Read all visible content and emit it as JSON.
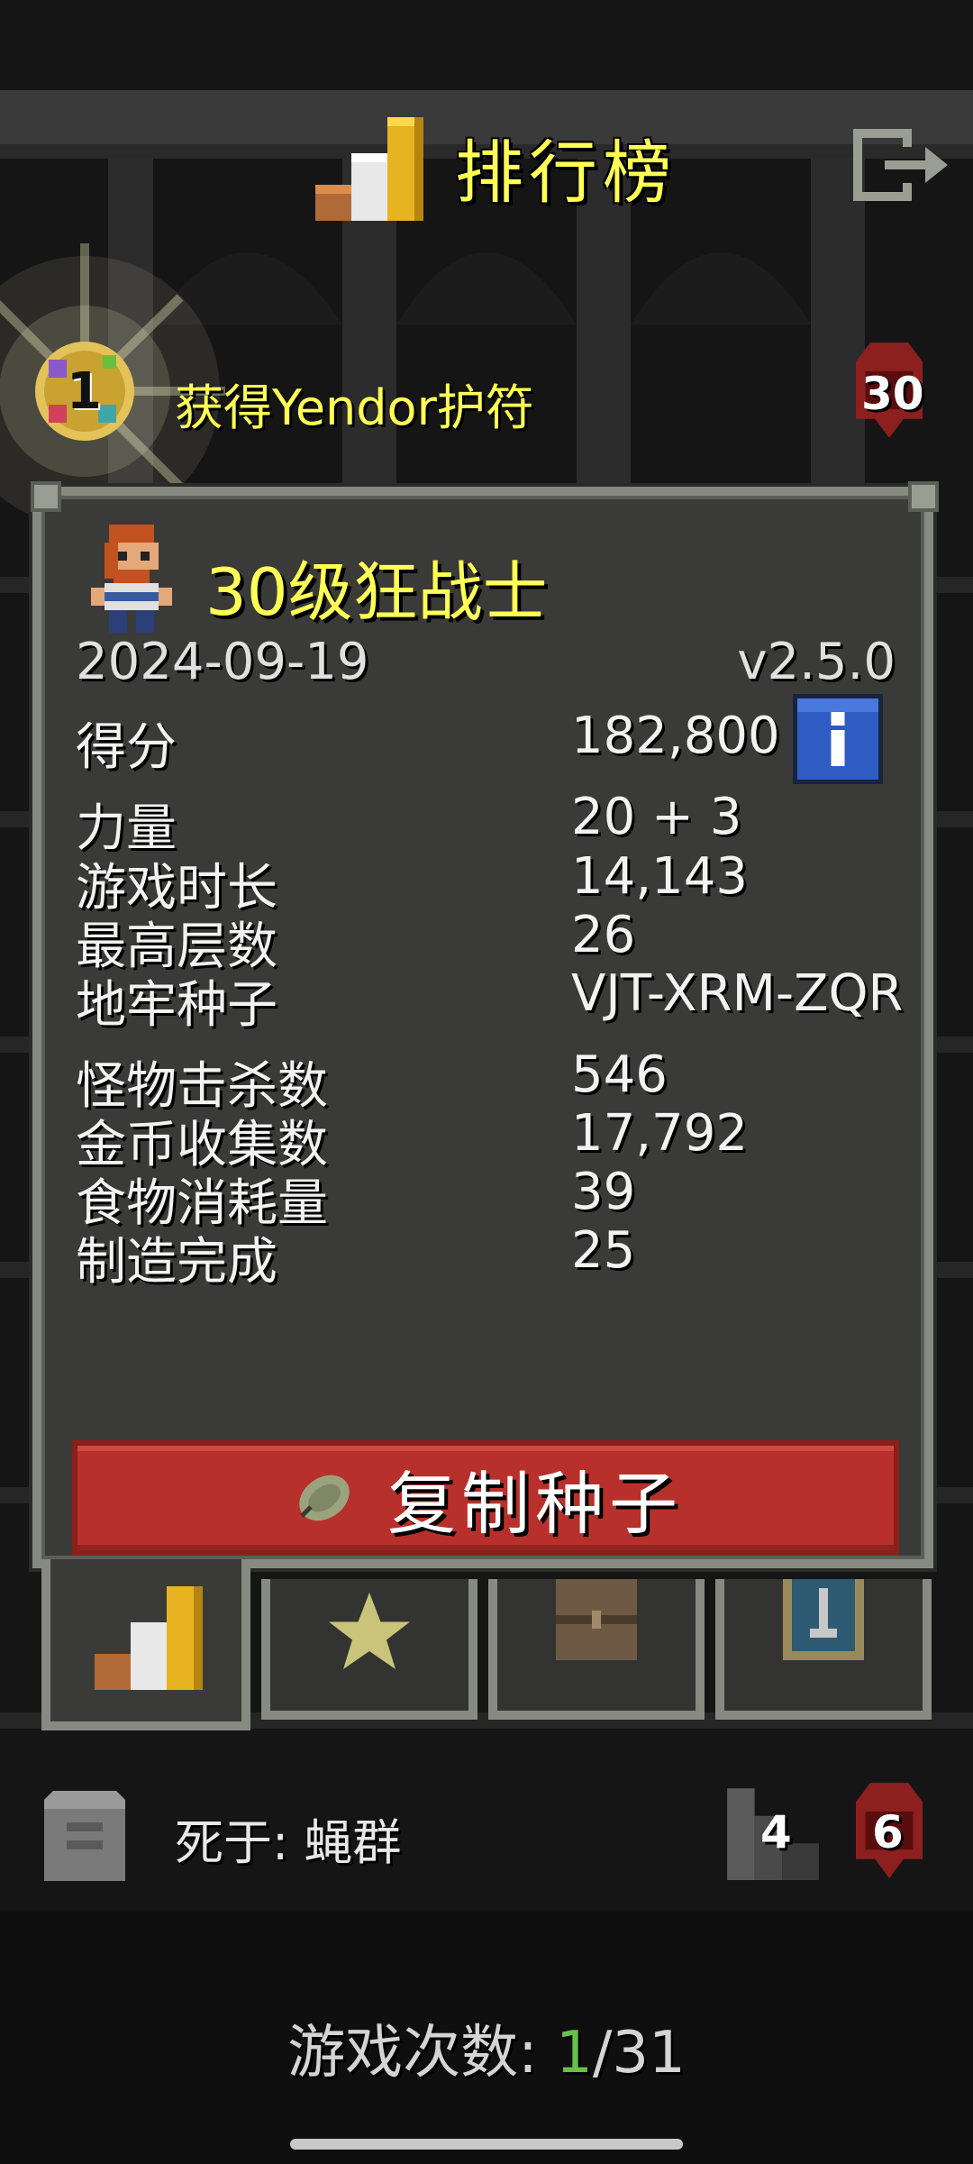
{
  "header": {
    "title": "排行榜"
  },
  "top_entry": {
    "rank": "1",
    "description": "获得Yendor护符",
    "level": "30"
  },
  "record": {
    "hero_title": "30级狂战士",
    "date": "2024-09-19",
    "version": "v2.5.0",
    "score_label": "得分",
    "score_value": "182,800",
    "stats": [
      {
        "label": "力量",
        "value": "20 + 3"
      },
      {
        "label": "游戏时长",
        "value": "14,143"
      },
      {
        "label": "最高层数",
        "value": "26"
      },
      {
        "label": "地牢种子",
        "value": "VJT-XRM-ZQR"
      },
      {
        "label": "怪物击杀数",
        "value": "546"
      },
      {
        "label": "金币收集数",
        "value": "17,792"
      },
      {
        "label": "食物消耗量",
        "value": "39"
      },
      {
        "label": "制造完成",
        "value": "25"
      }
    ],
    "copy_seed_label": "复制种子"
  },
  "tabs": [
    {
      "icon": "podium-icon",
      "active": true
    },
    {
      "icon": "star-icon",
      "active": false
    },
    {
      "icon": "backpack-icon",
      "active": false
    },
    {
      "icon": "badge-sword-icon",
      "active": false
    }
  ],
  "bottom_entry": {
    "description": "死于: 蝇群",
    "depth": "4",
    "level": "6"
  },
  "footer": {
    "games_label": "游戏次数:",
    "games_current": "1",
    "games_total": "/31"
  },
  "colors": {
    "title_yellow": "#ffff55",
    "panel_bg": "#3a3a38",
    "panel_border": "#878a80",
    "button_red": "#b8302b",
    "games_current_green": "#66c24a"
  }
}
